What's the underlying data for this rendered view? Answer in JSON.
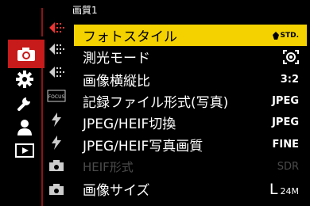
{
  "header": {
    "title": "画質1"
  },
  "colors": {
    "accent_red": "#c71a1a",
    "selection": "#f3d200"
  },
  "left_tabs": [
    {
      "name": "camera",
      "icon": "camera-icon",
      "active": true
    },
    {
      "name": "custom",
      "icon": "gear-icon",
      "active": false
    },
    {
      "name": "setup",
      "icon": "wrench-icon",
      "active": false
    },
    {
      "name": "my-menu",
      "icon": "person-icon",
      "active": false
    },
    {
      "name": "playback",
      "icon": "play-icon",
      "active": false
    }
  ],
  "sub_tabs": [
    {
      "icon": "arrow-left-icon",
      "active": true
    },
    {
      "icon": "arrow-left-dim-icon"
    },
    {
      "icon": "arrow-left-dim-icon"
    },
    {
      "icon": "focus-icon",
      "label": "FOCUS"
    },
    {
      "icon": "flash-icon"
    },
    {
      "icon": "flash-icon"
    },
    {
      "icon": "camera-small-icon"
    },
    {
      "icon": "camera-small-icon"
    }
  ],
  "menu": {
    "items": [
      {
        "label": "フォトスタイル",
        "value": "STD."
      },
      {
        "label": "測光モード",
        "value": ""
      },
      {
        "label": "画像横縦比",
        "value": "3:2"
      },
      {
        "label": "記録ファイル形式(写真)",
        "value": "JPEG"
      },
      {
        "label": "JPEG/HEIF切換",
        "value": "JPEG"
      },
      {
        "label": "JPEG/HEIF写真画質",
        "value": "FINE"
      },
      {
        "label": "HEIF形式",
        "value": "SDR"
      },
      {
        "label": "画像サイズ",
        "value_size": "L",
        "value_mp": "24M"
      }
    ]
  }
}
